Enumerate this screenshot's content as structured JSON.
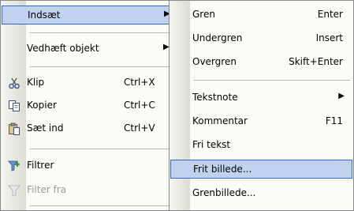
{
  "colors": {
    "menu_bg": "#fcfcf9",
    "highlight_bg": "#c1d2ee",
    "highlight_border": "#316ac5",
    "disabled_text": "#9a9a9a"
  },
  "left_menu": {
    "items": [
      {
        "label": "Indsæt",
        "has_submenu": true,
        "highlighted": true
      },
      {
        "label": "Vedhæft objekt",
        "has_submenu": true
      },
      {
        "label": "Klip",
        "shortcut": "Ctrl+X",
        "icon": "scissors-icon"
      },
      {
        "label": "Kopier",
        "shortcut": "Ctrl+C",
        "icon": "copy-icon"
      },
      {
        "label": "Sæt ind",
        "shortcut": "Ctrl+V",
        "icon": "paste-icon"
      },
      {
        "label": "Filtrer",
        "icon": "filter-icon"
      },
      {
        "label": "Filter fra",
        "icon": "filter-off-icon",
        "disabled": true
      }
    ]
  },
  "right_menu": {
    "items": [
      {
        "label": "Gren",
        "shortcut": "Enter"
      },
      {
        "label": "Undergren",
        "shortcut": "Insert"
      },
      {
        "label": "Overgren",
        "shortcut": "Skift+Enter"
      },
      {
        "label": "Tekstnote",
        "has_submenu": true
      },
      {
        "label": "Kommentar",
        "shortcut": "F11"
      },
      {
        "label": "Fri tekst"
      },
      {
        "label": "Frit billede...",
        "highlighted": true
      },
      {
        "label": "Grenbillede..."
      }
    ]
  }
}
